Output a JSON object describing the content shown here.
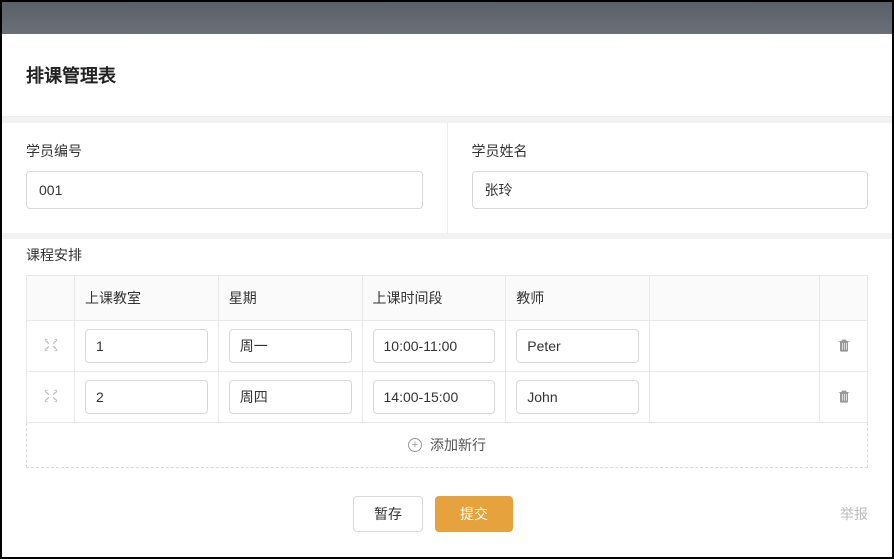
{
  "header": {
    "title": "排课管理表"
  },
  "form": {
    "studentId": {
      "label": "学员编号",
      "value": "001"
    },
    "studentName": {
      "label": "学员姓名",
      "value": "张玲"
    }
  },
  "table": {
    "title": "课程安排",
    "headers": {
      "classroom": "上课教室",
      "weekday": "星期",
      "timeslot": "上课时间段",
      "teacher": "教师"
    },
    "rows": [
      {
        "classroom": "1",
        "weekday": "周一",
        "timeslot": "10:00-11:00",
        "teacher": "Peter"
      },
      {
        "classroom": "2",
        "weekday": "周四",
        "timeslot": "14:00-15:00",
        "teacher": "John"
      }
    ],
    "addRowLabel": "添加新行"
  },
  "footer": {
    "saveDraft": "暂存",
    "submit": "提交",
    "report": "举报"
  }
}
